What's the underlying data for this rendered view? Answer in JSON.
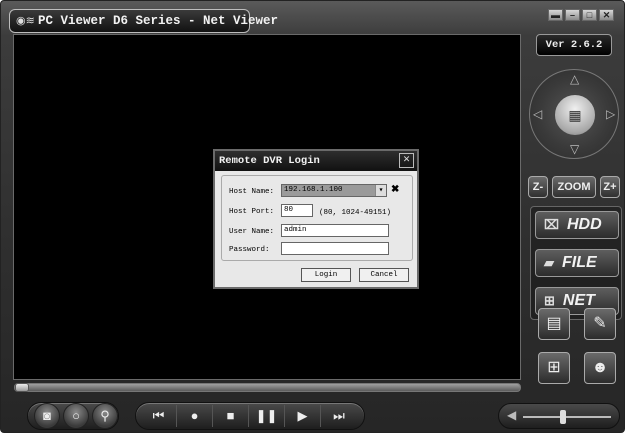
{
  "window": {
    "title": "PC Viewer D6 Series - Net Viewer",
    "app_icon": "camera-icon",
    "controls": [
      "minimize",
      "restore",
      "maximize",
      "close"
    ]
  },
  "version_label": "Ver 2.6.2",
  "playback": {
    "progress": 0.0
  },
  "zoom": {
    "zoom_out_label": "Z-",
    "zoom_label": "ZOOM",
    "zoom_in_label": "Z+"
  },
  "modes": {
    "hdd_label": "HDD",
    "file_label": "FILE",
    "net_label": "NET"
  },
  "dialog": {
    "title": "Remote DVR Login",
    "host_name_label": "Host Name:",
    "host_name_value": "192.168.1.100",
    "host_port_label": "Host Port:",
    "host_port_value": "80",
    "port_hint": "(80, 1024-49151)",
    "user_name_label": "User Name:",
    "user_name_value": "admin",
    "password_label": "Password:",
    "password_value": "",
    "login_label": "Login",
    "cancel_label": "Cancel"
  },
  "volume": {
    "level": 0.45
  }
}
